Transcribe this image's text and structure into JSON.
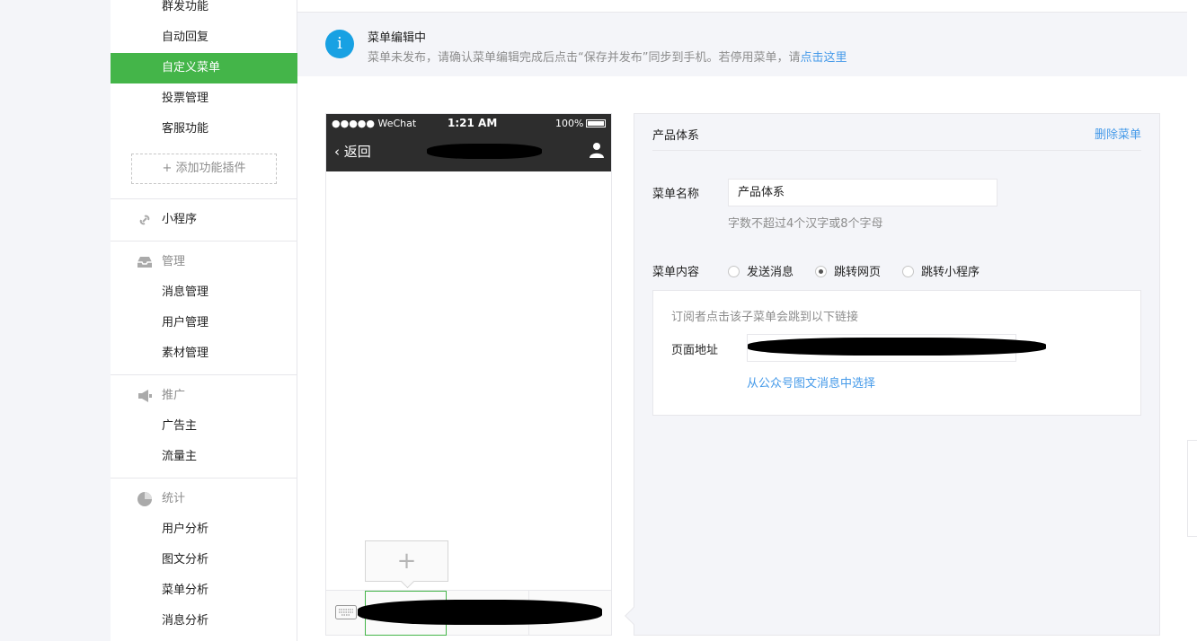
{
  "sidebar": {
    "items_top": [
      {
        "label": "群发功能"
      },
      {
        "label": "自动回复"
      },
      {
        "label": "自定义菜单",
        "active": true
      },
      {
        "label": "投票管理"
      },
      {
        "label": "客服功能"
      }
    ],
    "add_plugin": "+ 添加功能插件",
    "mini_program": {
      "label": "小程序",
      "icon": "link-icon"
    },
    "manage": {
      "label": "管理",
      "icon": "inbox-icon",
      "items": [
        "消息管理",
        "用户管理",
        "素材管理"
      ]
    },
    "promote": {
      "label": "推广",
      "icon": "megaphone-icon",
      "items": [
        "广告主",
        "流量主"
      ]
    },
    "stats": {
      "label": "统计",
      "icon": "pie-chart-icon",
      "items": [
        "用户分析",
        "图文分析",
        "菜单分析",
        "消息分析"
      ]
    }
  },
  "notice": {
    "title": "菜单编辑中",
    "desc": "菜单未发布，请确认菜单编辑完成后点击“保存并发布”同步到手机。若停用菜单，请",
    "link": "点击这里"
  },
  "phone": {
    "carrier": "●●●●● WeChat",
    "time": "1:21 AM",
    "battery": "100%",
    "back_label": "返回",
    "add_symbol": "+"
  },
  "editor": {
    "title": "产品体系",
    "delete_label": "删除菜单",
    "name_label": "菜单名称",
    "name_value": "产品体系",
    "name_hint": "字数不超过4个汉字或8个字母",
    "content_label": "菜单内容",
    "options": [
      "发送消息",
      "跳转网页",
      "跳转小程序"
    ],
    "selected_option": "跳转网页",
    "link_desc": "订阅者点击该子菜单会跳到以下链接",
    "url_label": "页面地址",
    "pick_link": "从公众号图文消息中选择"
  },
  "colors": {
    "accent_green": "#44b549",
    "link_blue": "#459ae9",
    "info_blue": "#18a1e3"
  }
}
